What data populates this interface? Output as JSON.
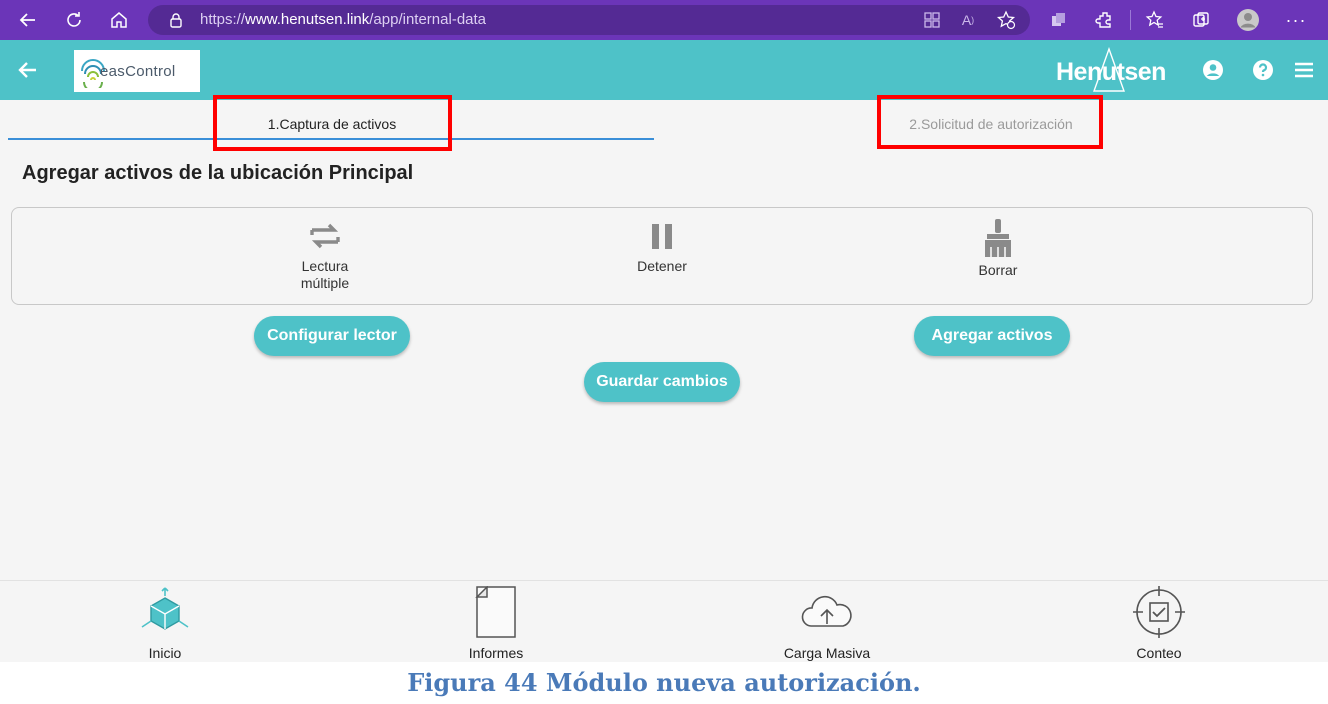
{
  "browser": {
    "url_prefix": "https://",
    "url_host": "www.henutsen.link",
    "url_path": "/app/internal-data"
  },
  "header": {
    "logo_text": "easControl",
    "brand": "Henutsen"
  },
  "tabs": [
    {
      "label": "1.Captura de activos"
    },
    {
      "label": "2.Solicitud de autorización"
    }
  ],
  "page": {
    "title": "Agregar activos de la ubicación Principal"
  },
  "tools": [
    {
      "label_line1": "Lectura",
      "label_line2": "múltiple",
      "icon": "repeat-icon"
    },
    {
      "label_line1": "Detener",
      "label_line2": "",
      "icon": "pause-icon"
    },
    {
      "label_line1": "Borrar",
      "label_line2": "",
      "icon": "broom-icon"
    }
  ],
  "buttons": {
    "configure": "Configurar lector",
    "add_assets": "Agregar activos",
    "save": "Guardar cambios"
  },
  "nav": [
    {
      "label": "Inicio",
      "icon": "cube-icon"
    },
    {
      "label": "Informes",
      "icon": "document-icon"
    },
    {
      "label": "Carga Masiva",
      "icon": "cloud-upload-icon"
    },
    {
      "label": "Conteo",
      "icon": "target-check-icon"
    }
  ],
  "caption": "Figura 44 Módulo nueva autorización.",
  "colors": {
    "browser": "#6b35b8",
    "accent": "#4ec2c8",
    "highlight": "#ff0000",
    "caption": "#4a7ab8"
  }
}
